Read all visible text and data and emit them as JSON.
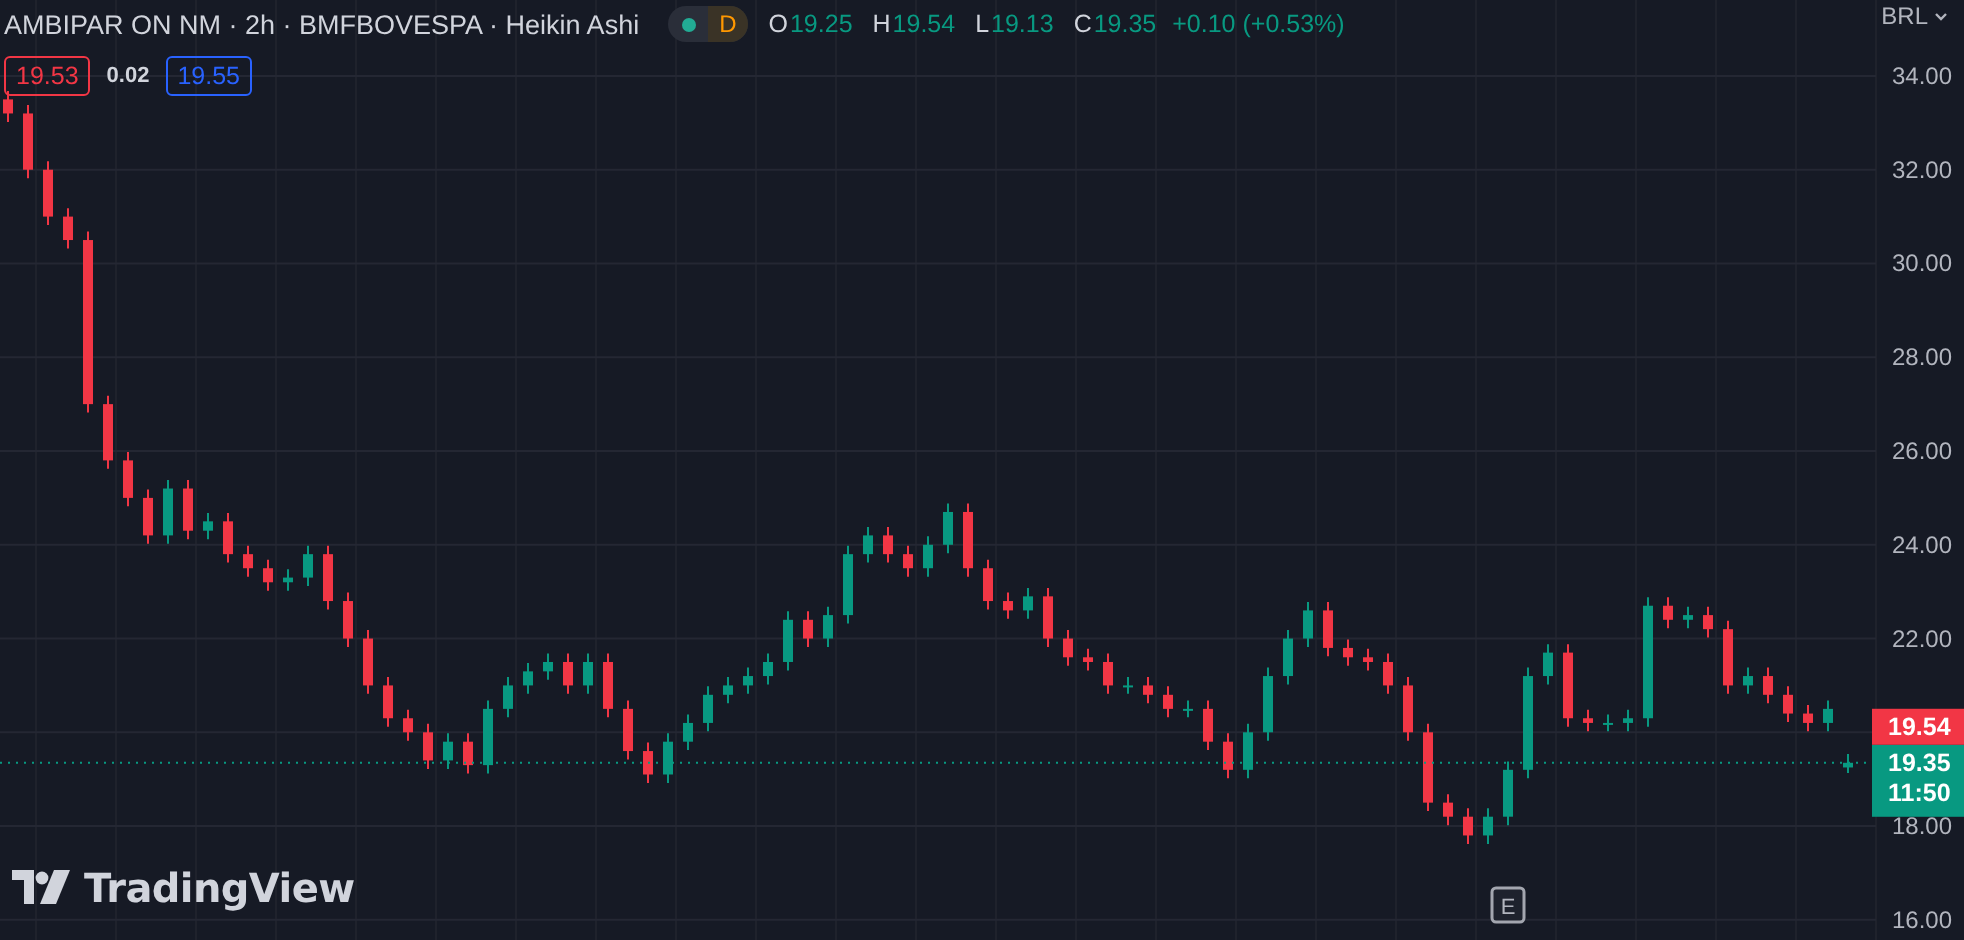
{
  "legend": {
    "title": "AMBIPAR ON NM · 2h · BMFBOVESPA · Heikin Ashi",
    "badge": "D",
    "ohlc": [
      {
        "label": "O",
        "value": "19.25"
      },
      {
        "label": "H",
        "value": "19.54"
      },
      {
        "label": "L",
        "value": "19.13"
      },
      {
        "label": "C",
        "value": "19.35"
      }
    ],
    "change": "+0.10 (+0.53%)"
  },
  "quote": {
    "bid": "19.53",
    "spread": "0.02",
    "ask": "19.55"
  },
  "currency": "BRL",
  "chart_data": {
    "type": "candlestick",
    "ylim": [
      15.57,
      35.62
    ],
    "grid": true,
    "yticks": [
      {
        "value": 16,
        "label": "16.00"
      },
      {
        "value": 18,
        "label": "18.00"
      },
      {
        "value": 22,
        "label": "22.00"
      },
      {
        "value": 24,
        "label": "24.00"
      },
      {
        "value": 26,
        "label": "26.00"
      },
      {
        "value": 28,
        "label": "28.00"
      },
      {
        "value": 30,
        "label": "30.00"
      },
      {
        "value": 32,
        "label": "32.00"
      },
      {
        "value": 34,
        "label": "34.00"
      }
    ],
    "ohlc": [
      [
        33.5,
        33.68,
        33.02,
        33.2
      ],
      [
        33.2,
        33.38,
        31.82,
        32
      ],
      [
        32,
        32.18,
        30.82,
        31
      ],
      [
        31,
        31.18,
        30.32,
        30.5
      ],
      [
        30.5,
        30.68,
        26.82,
        27
      ],
      [
        27,
        27.18,
        25.62,
        25.8
      ],
      [
        25.8,
        25.98,
        24.82,
        25
      ],
      [
        25,
        25.18,
        24.02,
        24.2
      ],
      [
        24.2,
        25.38,
        24.02,
        25.2
      ],
      [
        25.2,
        25.38,
        24.12,
        24.3
      ],
      [
        24.3,
        24.68,
        24.12,
        24.5
      ],
      [
        24.5,
        24.68,
        23.62,
        23.8
      ],
      [
        23.8,
        23.98,
        23.32,
        23.5
      ],
      [
        23.5,
        23.68,
        23.02,
        23.2
      ],
      [
        23.2,
        23.48,
        23.02,
        23.3
      ],
      [
        23.3,
        23.98,
        23.12,
        23.8
      ],
      [
        23.8,
        23.98,
        22.62,
        22.8
      ],
      [
        22.8,
        22.98,
        21.82,
        22
      ],
      [
        22,
        22.18,
        20.82,
        21
      ],
      [
        21,
        21.18,
        20.12,
        20.3
      ],
      [
        20.3,
        20.48,
        19.82,
        20
      ],
      [
        20,
        20.18,
        19.22,
        19.4
      ],
      [
        19.4,
        19.98,
        19.22,
        19.8
      ],
      [
        19.8,
        19.98,
        19.12,
        19.3
      ],
      [
        19.3,
        20.68,
        19.12,
        20.5
      ],
      [
        20.5,
        21.18,
        20.32,
        21
      ],
      [
        21,
        21.48,
        20.82,
        21.3
      ],
      [
        21.3,
        21.68,
        21.12,
        21.5
      ],
      [
        21.5,
        21.68,
        20.82,
        21
      ],
      [
        21,
        21.68,
        20.82,
        21.5
      ],
      [
        21.5,
        21.68,
        20.32,
        20.5
      ],
      [
        20.5,
        20.68,
        19.42,
        19.6
      ],
      [
        19.6,
        19.78,
        18.92,
        19.1
      ],
      [
        19.1,
        19.98,
        18.92,
        19.8
      ],
      [
        19.8,
        20.38,
        19.62,
        20.2
      ],
      [
        20.2,
        20.98,
        20.02,
        20.8
      ],
      [
        20.8,
        21.18,
        20.62,
        21
      ],
      [
        21,
        21.38,
        20.82,
        21.2
      ],
      [
        21.2,
        21.68,
        21.02,
        21.5
      ],
      [
        21.5,
        22.58,
        21.32,
        22.4
      ],
      [
        22.4,
        22.58,
        21.82,
        22
      ],
      [
        22,
        22.68,
        21.82,
        22.5
      ],
      [
        22.5,
        23.98,
        22.32,
        23.8
      ],
      [
        23.8,
        24.38,
        23.62,
        24.2
      ],
      [
        24.2,
        24.38,
        23.62,
        23.8
      ],
      [
        23.8,
        23.98,
        23.32,
        23.5
      ],
      [
        23.5,
        24.18,
        23.32,
        24
      ],
      [
        24,
        24.88,
        23.82,
        24.7
      ],
      [
        24.7,
        24.88,
        23.32,
        23.5
      ],
      [
        23.5,
        23.68,
        22.62,
        22.8
      ],
      [
        22.8,
        22.98,
        22.42,
        22.6
      ],
      [
        22.6,
        23.08,
        22.42,
        22.9
      ],
      [
        22.9,
        23.08,
        21.82,
        22
      ],
      [
        22,
        22.18,
        21.42,
        21.6
      ],
      [
        21.6,
        21.78,
        21.32,
        21.5
      ],
      [
        21.5,
        21.68,
        20.82,
        21
      ],
      [
        21,
        21.18,
        20.82,
        21
      ],
      [
        21,
        21.18,
        20.62,
        20.8
      ],
      [
        20.8,
        20.98,
        20.32,
        20.5
      ],
      [
        20.5,
        20.68,
        20.32,
        20.5
      ],
      [
        20.5,
        20.68,
        19.62,
        19.8
      ],
      [
        19.8,
        19.98,
        19.02,
        19.2
      ],
      [
        19.2,
        20.18,
        19.02,
        20
      ],
      [
        20,
        21.38,
        19.82,
        21.2
      ],
      [
        21.2,
        22.18,
        21.02,
        22
      ],
      [
        22,
        22.78,
        21.82,
        22.6
      ],
      [
        22.6,
        22.78,
        21.62,
        21.8
      ],
      [
        21.8,
        21.98,
        21.42,
        21.6
      ],
      [
        21.6,
        21.78,
        21.32,
        21.5
      ],
      [
        21.5,
        21.68,
        20.82,
        21
      ],
      [
        21,
        21.18,
        19.82,
        20
      ],
      [
        20,
        20.18,
        18.32,
        18.5
      ],
      [
        18.5,
        18.68,
        18.02,
        18.2
      ],
      [
        18.2,
        18.38,
        17.62,
        17.8
      ],
      [
        17.8,
        18.38,
        17.62,
        18.2
      ],
      [
        18.2,
        19.38,
        18.02,
        19.2
      ],
      [
        19.2,
        21.38,
        19.02,
        21.2
      ],
      [
        21.2,
        21.88,
        21.02,
        21.7
      ],
      [
        21.7,
        21.88,
        20.12,
        20.3
      ],
      [
        20.3,
        20.48,
        20.02,
        20.2
      ],
      [
        20.2,
        20.38,
        20.02,
        20.2
      ],
      [
        20.2,
        20.48,
        20.02,
        20.3
      ],
      [
        20.3,
        22.88,
        20.12,
        22.7
      ],
      [
        22.7,
        22.88,
        22.22,
        22.4
      ],
      [
        22.4,
        22.68,
        22.22,
        22.5
      ],
      [
        22.5,
        22.68,
        22.02,
        22.2
      ],
      [
        22.2,
        22.38,
        20.82,
        21
      ],
      [
        21,
        21.38,
        20.82,
        21.2
      ],
      [
        21.2,
        21.38,
        20.62,
        20.8
      ],
      [
        20.8,
        20.98,
        20.22,
        20.4
      ],
      [
        20.4,
        20.58,
        20.02,
        20.2
      ],
      [
        20.2,
        20.68,
        20.02,
        20.5
      ],
      [
        19.25,
        19.54,
        19.13,
        19.35
      ]
    ],
    "ref_lines": [
      {
        "axis": "y",
        "value": 19.35,
        "label": "19.35",
        "color": "#089981"
      }
    ]
  },
  "countdown": "11:50",
  "price_labels": [
    {
      "kind": "high",
      "text": "19.54"
    }
  ],
  "markers": [
    {
      "label": "E"
    }
  ],
  "logo": "TradingView"
}
